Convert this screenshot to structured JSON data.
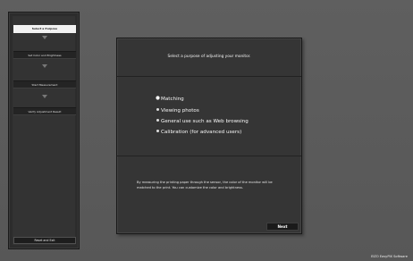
{
  "sidebar": {
    "steps": [
      {
        "label": "Select a Purpose"
      },
      {
        "label": "Set Color and Brightness"
      },
      {
        "label": "Start Measurement"
      },
      {
        "label": "Verify Adjustment Result"
      }
    ],
    "reset_label": "Reset and Exit"
  },
  "main": {
    "instruction": "Select a purpose of adjusting your monitor.",
    "options": [
      {
        "label": "Matching"
      },
      {
        "label": "Viewing photos"
      },
      {
        "label": "General use such as Web browsing"
      },
      {
        "label": "Calibration (for advanced users)"
      }
    ],
    "selected_option": "Matching",
    "description": "By measuring the printing paper through the sensor, the color of the monitor will be matched to the print. You can customize the color and brightness.",
    "next_label": "Next"
  },
  "footer": {
    "brand": "EIZO EasyPIX Software"
  }
}
